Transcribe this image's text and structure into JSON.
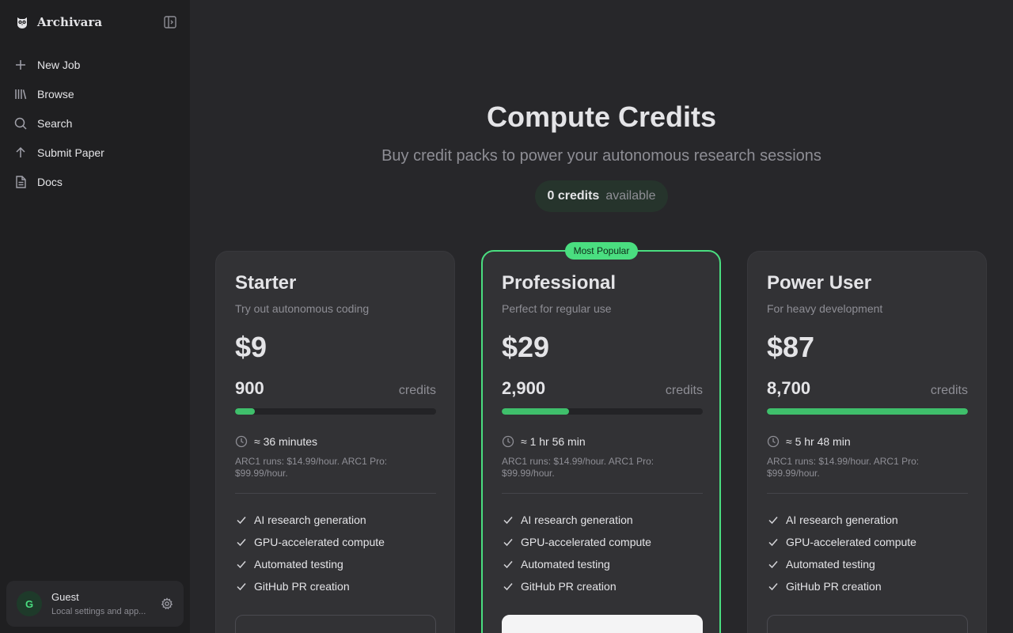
{
  "app": {
    "name": "Archivara"
  },
  "sidebar": {
    "items": [
      {
        "label": "New Job",
        "icon": "plus-icon"
      },
      {
        "label": "Browse",
        "icon": "library-icon"
      },
      {
        "label": "Search",
        "icon": "search-icon"
      },
      {
        "label": "Submit Paper",
        "icon": "arrow-up-icon"
      },
      {
        "label": "Docs",
        "icon": "file-text-icon"
      }
    ],
    "user": {
      "initial": "G",
      "name": "Guest",
      "subtitle": "Local settings and app..."
    }
  },
  "page": {
    "title": "Compute Credits",
    "subtitle": "Buy credit packs to power your autonomous research sessions",
    "balance": {
      "value": "0 credits",
      "label": "available"
    }
  },
  "plans": [
    {
      "name": "Starter",
      "description": "Try out autonomous coding",
      "price": "$9",
      "credits": "900",
      "credits_label": "credits",
      "bar_fraction": 0.1,
      "time": "≈ 36 minutes",
      "rate_note": "ARC1 runs: $14.99/hour. ARC1 Pro: $99.99/hour.",
      "features": [
        "AI research generation",
        "GPU-accelerated compute",
        "Automated testing",
        "GitHub PR creation"
      ],
      "popular": false
    },
    {
      "name": "Professional",
      "description": "Perfect for regular use",
      "price": "$29",
      "credits": "2,900",
      "credits_label": "credits",
      "bar_fraction": 0.333,
      "time": "≈ 1 hr 56 min",
      "rate_note": "ARC1 runs: $14.99/hour. ARC1 Pro: $99.99/hour.",
      "features": [
        "AI research generation",
        "GPU-accelerated compute",
        "Automated testing",
        "GitHub PR creation"
      ],
      "popular": true,
      "badge": "Most Popular"
    },
    {
      "name": "Power User",
      "description": "For heavy development",
      "price": "$87",
      "credits": "8,700",
      "credits_label": "credits",
      "bar_fraction": 1.0,
      "time": "≈ 5 hr 48 min",
      "rate_note": "ARC1 runs: $14.99/hour. ARC1 Pro: $99.99/hour.",
      "features": [
        "AI research generation",
        "GPU-accelerated compute",
        "Automated testing",
        "GitHub PR creation"
      ],
      "popular": false
    }
  ],
  "colors": {
    "accent": "#4ade80",
    "bar": "#3fbf6b",
    "background": "#27272a",
    "sidebar": "#1f1f21",
    "card": "#323235"
  }
}
